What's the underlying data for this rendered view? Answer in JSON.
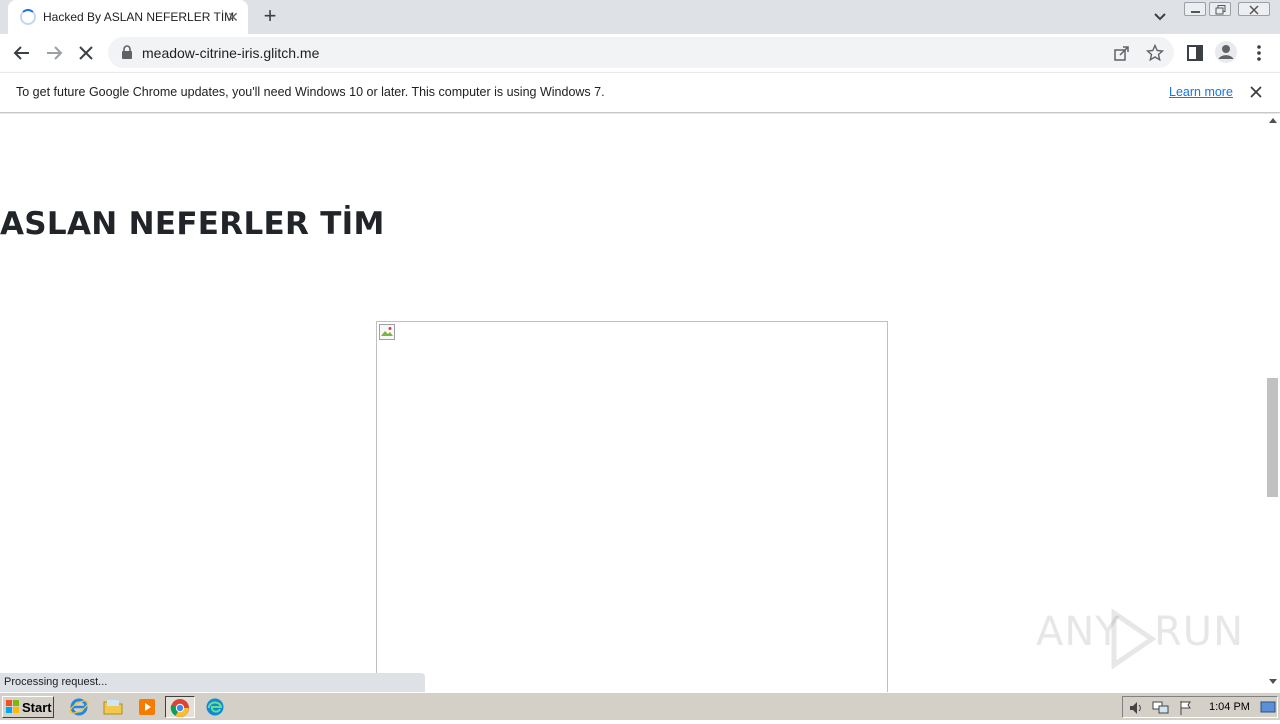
{
  "browser": {
    "tab": {
      "title": "Hacked By ASLAN NEFERLER TİM",
      "close_glyph": "✕",
      "loading": true
    },
    "new_tab_glyph": "+",
    "address": {
      "url": "meadow-citrine-iris.glitch.me"
    },
    "toolbar_icons": [
      "back-icon",
      "forward-icon",
      "stop-icon",
      "lock-icon",
      "share-icon",
      "star-icon",
      "side-panel-icon",
      "profile-icon",
      "menu-icon"
    ]
  },
  "infobar": {
    "message": "To get future Google Chrome updates, you'll need Windows 10 or later. This computer is using Windows 7.",
    "link": "Learn more"
  },
  "page": {
    "heading": "ASLAN NEFERLER TİM",
    "status": "Processing request..."
  },
  "watermark": {
    "text_left": "ANY",
    "text_right": "RUN"
  },
  "taskbar": {
    "start_label": "Start",
    "clock": "1:04 PM",
    "apps": [
      "ie-icon",
      "explorer-icon",
      "media-player-icon",
      "chrome-icon",
      "edge-icon"
    ]
  },
  "colors": {
    "accent": "#1a73e8",
    "tabstrip": "#dee1e6",
    "heading": "#212529",
    "taskbar": "#d4d0c8"
  }
}
